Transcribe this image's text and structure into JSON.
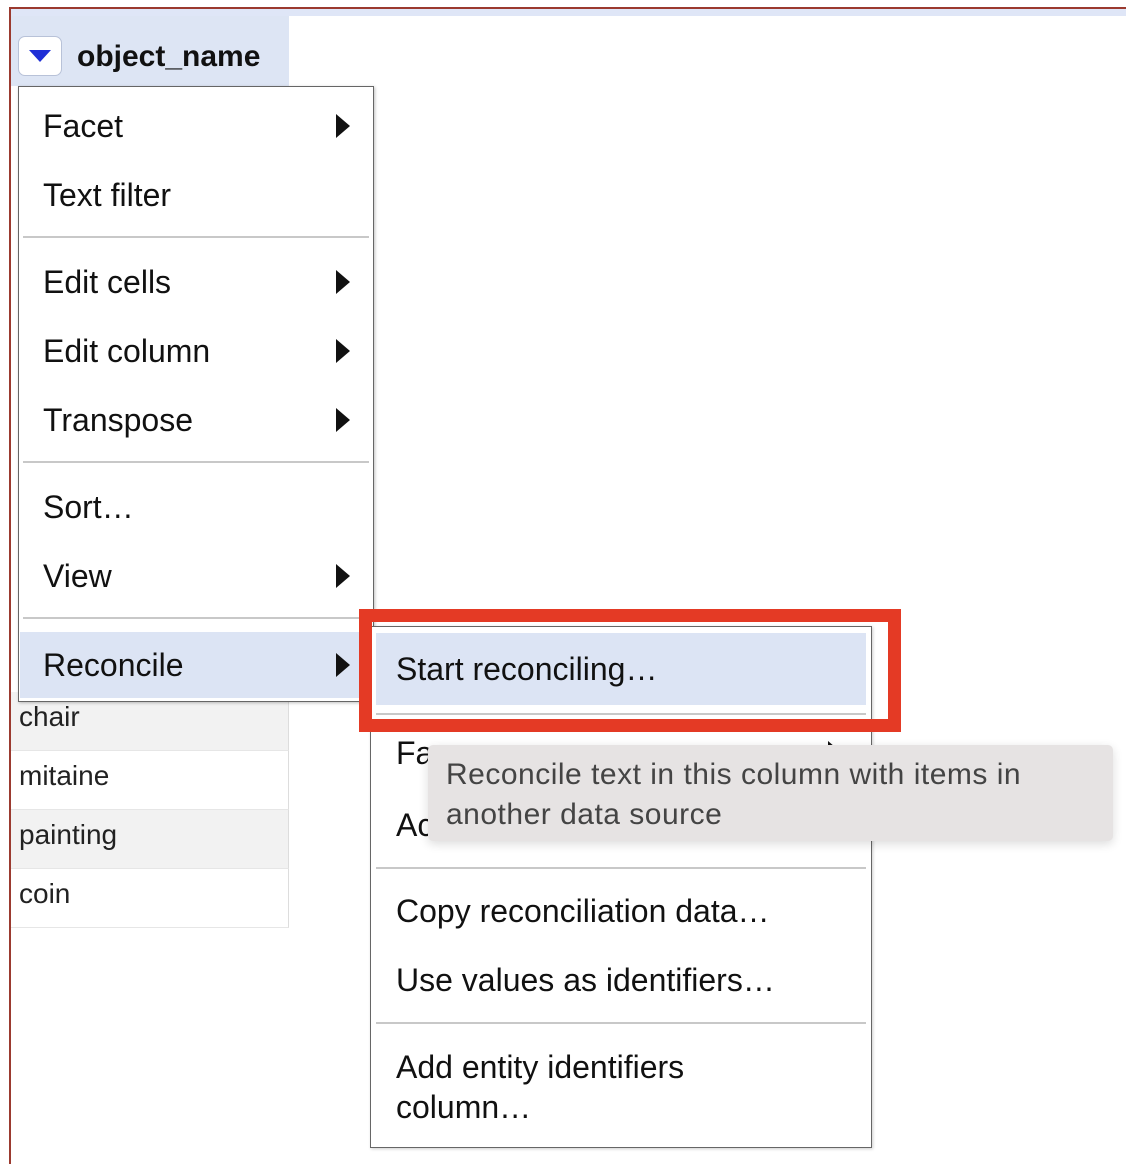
{
  "column": {
    "title": "object_name",
    "dropdown_icon": "triangle-down-icon",
    "accent": "#1f2fd6"
  },
  "cells": [
    "chair",
    "mitaine",
    "painting",
    "coin"
  ],
  "menu": {
    "facet": "Facet",
    "text_filter": "Text filter",
    "edit_cells": "Edit cells",
    "edit_column": "Edit column",
    "transpose": "Transpose",
    "sort": "Sort…",
    "view": "View",
    "reconcile": "Reconcile"
  },
  "submenu": {
    "start_reconciling": "Start reconciling…",
    "facets_partial": "Fa",
    "actions_partial": "Ac",
    "copy_reconciliation": "Copy reconciliation data…",
    "use_values": "Use values as identifiers…",
    "add_entity": "Add entity identifiers column…"
  },
  "tooltip": {
    "text": "Reconcile text in this column with items in another data source"
  },
  "colors": {
    "highlight": "#dce4f4",
    "annotation_box": "#e43a25"
  }
}
